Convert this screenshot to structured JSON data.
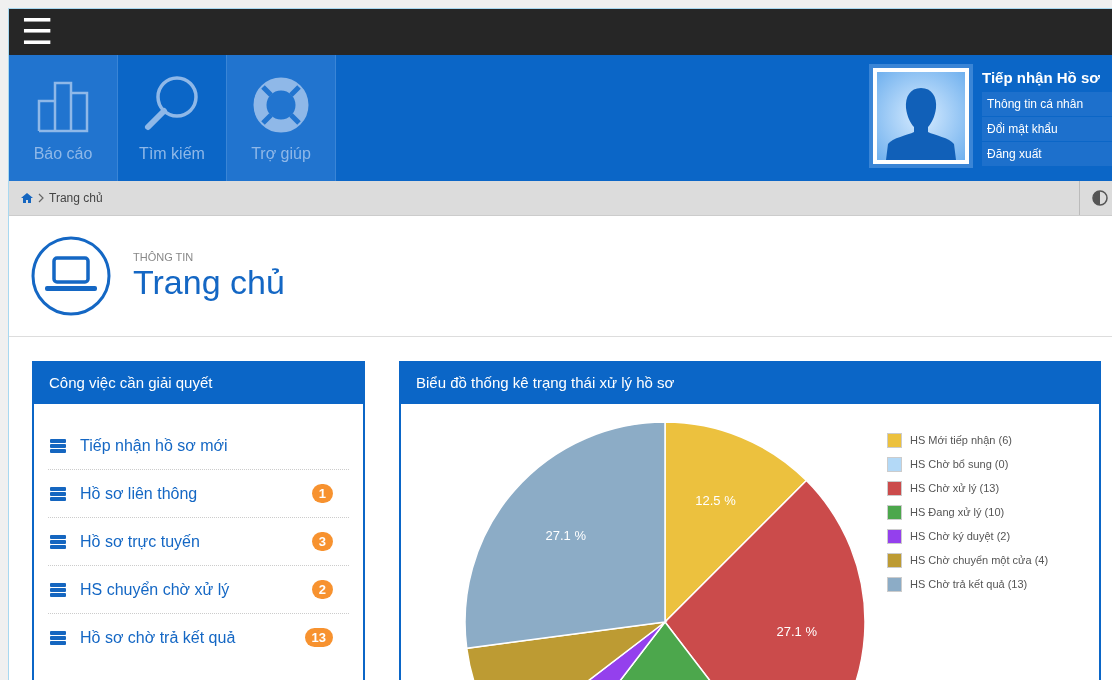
{
  "topbar": {
    "menu": "☰"
  },
  "nav": [
    {
      "label": "Báo cáo",
      "kind": "chart"
    },
    {
      "label": "Tìm kiếm",
      "kind": "search"
    },
    {
      "label": "Trợ giúp",
      "kind": "help"
    }
  ],
  "user": {
    "name": "Tiếp nhận Hồ sơ",
    "menu": [
      "Thông tin cá nhân",
      "Đổi mật khẩu",
      "Đăng xuất"
    ]
  },
  "breadcrumb": {
    "current": "Trang chủ"
  },
  "page_header": {
    "subtitle": "THÔNG TIN",
    "title": "Trang chủ"
  },
  "tasks": {
    "title": "Công việc cần giải quyết",
    "items": [
      {
        "label": "Tiếp nhận hồ sơ mới"
      },
      {
        "label": "Hồ sơ liên thông",
        "count": "1"
      },
      {
        "label": "Hồ sơ trực tuyến",
        "count": "3"
      },
      {
        "label": "HS chuyển chờ xử lý",
        "count": "2"
      },
      {
        "label": "Hồ sơ chờ trả kết quả",
        "count": "13"
      }
    ]
  },
  "chart_panel": {
    "title": "Biểu đồ thống kê trạng thái xử lý hồ sơ",
    "chart_data": {
      "type": "pie",
      "value_labels": [
        "12.5 %",
        null,
        "27.1 %",
        null,
        null,
        null,
        "27.1 %"
      ],
      "categories": [
        "HS Mới tiếp nhận (6)",
        "HS Chờ bổ sung (0)",
        "HS Chờ xử lý (13)",
        "HS Đang xử lý (10)",
        "HS Chờ ký duyệt (2)",
        "HS Chờ chuyển một cửa (4)",
        "HS Chờ trả kết quả (13)"
      ],
      "colors": [
        "#ecc13e",
        "#b3d9f7",
        "#cb4b4b",
        "#4ca74c",
        "#9440ed",
        "#bd9b33",
        "#8cacc6"
      ],
      "values": [
        12.5,
        0,
        27.1,
        20.8,
        4.2,
        8.3,
        27.1
      ]
    }
  }
}
